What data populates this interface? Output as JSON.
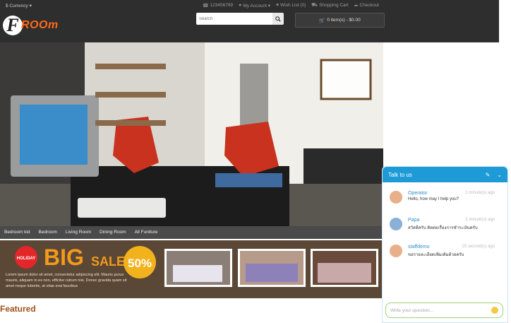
{
  "topbar": {
    "currency": "$ Currency ▾",
    "phone": "123456789",
    "my_account": "My Account ▾",
    "wish_list": "Wish List (0)",
    "shopping_cart": "Shopping Cart",
    "checkout": "Checkout"
  },
  "logo": {
    "mark": "F",
    "text": "ROOm"
  },
  "search": {
    "placeholder": "Search"
  },
  "cart": {
    "label": "0 item(s) - $0.00"
  },
  "menu": [
    "Bedroom kid",
    "Bedroom",
    "Living Room",
    "Dining Room",
    "All Funiture"
  ],
  "banner": {
    "badge": "HOLIDAY",
    "big": "BIG",
    "sale": "SALE",
    "percent": "50%",
    "desc": "Lorem ipsum dolor sit amet, consectetur adipiscing elit. Mauris purus mauris, aliquam in ex non, efficitur rutrum nisi. Donec gravida quam sit amet neque lobortis, at vitae erat faucibus"
  },
  "featured_title": "Featured",
  "chat": {
    "title": "Talk to us",
    "messages": [
      {
        "name": "Operator",
        "time": "1 minute(s) ago",
        "text": "Hello, how may I help you?"
      },
      {
        "name": "Papa",
        "time": "1 minute(s) ago",
        "text": "สวัสดีครับ ติดต่อเรื่องการชำระเงินครับ"
      },
      {
        "name": "staffdemo",
        "time": "20 second(s) ago",
        "text": "ขอรายละเอียดเพิ่มเติมด้วยครับ"
      }
    ],
    "input_placeholder": "Write your question...",
    "colors": {
      "header": "#1e9ad6",
      "name": "#2b8fcf",
      "input_border": "#9fd27a"
    }
  },
  "colors": {
    "accent": "#ff6a1a",
    "header_bg": "#2e2e2e",
    "featured": "#a0521c"
  }
}
